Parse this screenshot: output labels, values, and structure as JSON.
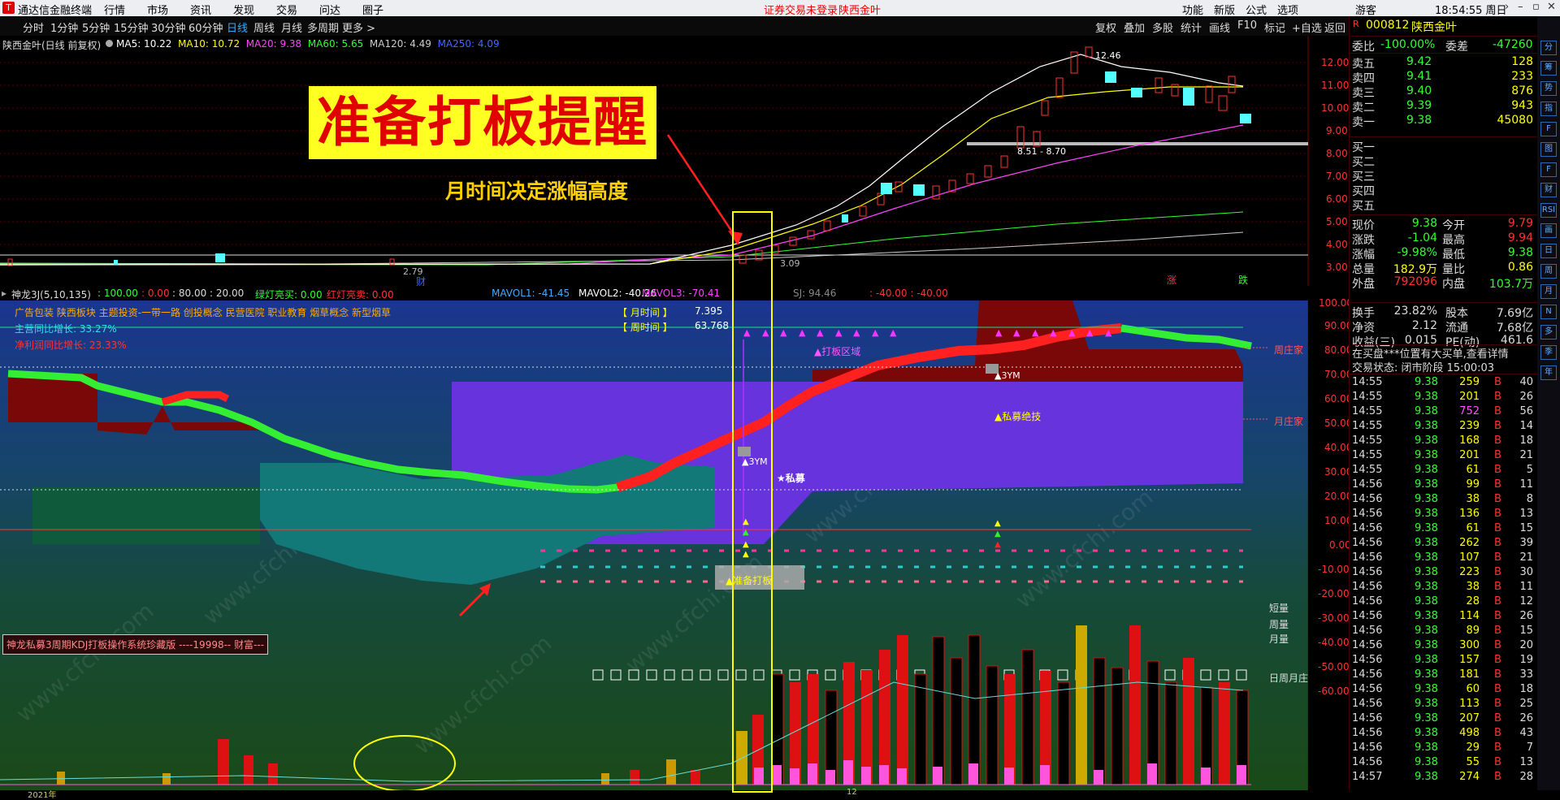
{
  "app": {
    "name": "通达信金融终端",
    "menus": [
      "行情",
      "市场",
      "资讯",
      "发现",
      "交易",
      "问达",
      "圈子"
    ],
    "notice": "证券交易未登录",
    "notice_stock": "陕西金叶",
    "right_menus": [
      "功能",
      "新版",
      "公式",
      "选项"
    ],
    "user": "游客",
    "clock": "18:54:55 周日"
  },
  "periods": [
    "分时",
    "1分钟",
    "5分钟",
    "15分钟",
    "30分钟",
    "60分钟",
    "日线",
    "周线",
    "月线",
    "多周期",
    "更多 >"
  ],
  "active_period": "日线",
  "toolbar": [
    "复权",
    "叠加",
    "多股",
    "统计",
    "画线",
    "F10",
    "标记",
    "+自选",
    "返回"
  ],
  "main": {
    "title": "陕西金叶(日线 前复权)",
    "ma": [
      {
        "label": "MA5: 10.22",
        "color": "#ffffff"
      },
      {
        "label": "MA10: 10.72",
        "color": "#ffff00"
      },
      {
        "label": "MA20: 9.38",
        "color": "#ff44ff"
      },
      {
        "label": "MA60: 5.65",
        "color": "#33ff33"
      },
      {
        "label": "MA120: 4.49",
        "color": "#cccccc"
      },
      {
        "label": "MA250: 4.09",
        "color": "#4466ff"
      }
    ],
    "banner": "准备打板提醒",
    "subtitle": "月时间决定涨幅高度",
    "high_label": "12.46",
    "range_label": "8.51 - 8.70",
    "low_label_1": "2.79",
    "low_label_2": "3.09",
    "marker_cai": "财",
    "marker_zhang": "涨",
    "marker_die": "跌",
    "price_ticks": [
      "12.00",
      "11.00",
      "10.00",
      "9.00",
      "8.00",
      "7.00",
      "6.00",
      "5.00",
      "4.00",
      "3.00"
    ]
  },
  "indicator_line": {
    "name": "神龙3J(5,10,135)",
    "vals": [
      ": 100.00",
      ": 0.00",
      ": 80.00 : 20.00"
    ],
    "green": "绿灯亮买: 0.00",
    "red": "红灯亮卖: 0.00",
    "mavol1": "MAVOL1: -41.45",
    "mavol2": "MAVOL2: -40.26",
    "mavol3": "MAVOL3: -70.41",
    "sj": "SJ: 94.46",
    "tail": ": -40.00  : -40.00"
  },
  "lower": {
    "concepts": "广告包装 陕西板块 主题投资-一带一路 创投概念 民营医院 职业教育 烟草概念 新型烟草",
    "growth1": "主营同比增长: 33.27%",
    "growth2": "净利润同比增长: 23.33%",
    "month_time_label": "【 月时间 】",
    "month_time_val": "7.395",
    "week_time_label": "【 周时间 】",
    "week_time_val": "63.768",
    "zone": "▲打板区域",
    "ym1": "▲3YM",
    "ym2": "▲3YM",
    "private": "★私募",
    "private_breakout": "▲私募绝技",
    "ready": "▲准备打板",
    "zhou_zhuang": "周庄家",
    "yue_zhuang": "月庄家",
    "short_vol": "短量",
    "week_vol": "周量",
    "month_vol": "月量",
    "dwm": "日周月庄",
    "signature": "神龙私募3周期KDJ打板操作系统珍藏版 ----19998-- 财富---",
    "axis": [
      "100.00",
      "90.00",
      "80.00",
      "70.00",
      "60.00",
      "50.00",
      "40.00",
      "30.00",
      "20.00",
      "10.00",
      "0.00",
      "-10.00",
      "-20.00",
      "-30.00",
      "-40.00",
      "-50.00",
      "-60.00"
    ],
    "watermark": "www.cfchi.com",
    "date_start": "2021年",
    "date_mid": "12"
  },
  "quote": {
    "code": "000812",
    "name": "陕西金叶",
    "wei_bi_label": "委比",
    "wei_bi": "-100.00%",
    "wei_cha_label": "委差",
    "wei_cha": "-47260",
    "asks": [
      {
        "label": "卖五",
        "price": "9.42",
        "vol": "128"
      },
      {
        "label": "卖四",
        "price": "9.41",
        "vol": "233"
      },
      {
        "label": "卖三",
        "price": "9.40",
        "vol": "876"
      },
      {
        "label": "卖二",
        "price": "9.39",
        "vol": "943"
      },
      {
        "label": "卖一",
        "price": "9.38",
        "vol": "45080"
      }
    ],
    "bids": [
      "买一",
      "买二",
      "买三",
      "买四",
      "买五"
    ],
    "stats": [
      {
        "l1": "现价",
        "v1": "9.38",
        "l2": "今开",
        "v2": "9.79",
        "c1": "#33ff33",
        "c2": "#ff3333"
      },
      {
        "l1": "涨跌",
        "v1": "-1.04",
        "l2": "最高",
        "v2": "9.94",
        "c1": "#33ff33",
        "c2": "#ff3333"
      },
      {
        "l1": "涨幅",
        "v1": "-9.98%",
        "l2": "最低",
        "v2": "9.38",
        "c1": "#33ff33",
        "c2": "#33ff33"
      },
      {
        "l1": "总量",
        "v1": "182.9万",
        "l2": "量比",
        "v2": "0.86",
        "c1": "#ffff00",
        "c2": "#ffff00"
      },
      {
        "l1": "外盘",
        "v1": "792096",
        "l2": "内盘",
        "v2": "103.7万",
        "c1": "#ff3333",
        "c2": "#33ff33"
      }
    ],
    "stats2": [
      {
        "l1": "换手",
        "v1": "23.82%",
        "l2": "股本",
        "v2": "7.69亿"
      },
      {
        "l1": "净资",
        "v1": "2.12",
        "l2": "流通",
        "v2": "7.68亿"
      },
      {
        "l1": "收益(三)",
        "v1": "0.015",
        "l2": "PE(动)",
        "v2": "461.6"
      }
    ],
    "notice": "在买盘***位置有大买单,查看详情",
    "status": "交易状态: 闭市阶段 15:00:03",
    "ticks": [
      {
        "t": "14:55",
        "p": "9.38",
        "v": "259",
        "s": "B",
        "n": "40"
      },
      {
        "t": "14:55",
        "p": "9.38",
        "v": "201",
        "s": "B",
        "n": "26"
      },
      {
        "t": "14:55",
        "p": "9.38",
        "v": "752",
        "s": "B",
        "n": "56"
      },
      {
        "t": "14:55",
        "p": "9.38",
        "v": "239",
        "s": "B",
        "n": "14"
      },
      {
        "t": "14:55",
        "p": "9.38",
        "v": "168",
        "s": "B",
        "n": "18"
      },
      {
        "t": "14:55",
        "p": "9.38",
        "v": "201",
        "s": "B",
        "n": "21"
      },
      {
        "t": "14:55",
        "p": "9.38",
        "v": "61",
        "s": "B",
        "n": "5"
      },
      {
        "t": "14:56",
        "p": "9.38",
        "v": "99",
        "s": "B",
        "n": "11"
      },
      {
        "t": "14:56",
        "p": "9.38",
        "v": "38",
        "s": "B",
        "n": "8"
      },
      {
        "t": "14:56",
        "p": "9.38",
        "v": "136",
        "s": "B",
        "n": "13"
      },
      {
        "t": "14:56",
        "p": "9.38",
        "v": "61",
        "s": "B",
        "n": "15"
      },
      {
        "t": "14:56",
        "p": "9.38",
        "v": "262",
        "s": "B",
        "n": "39"
      },
      {
        "t": "14:56",
        "p": "9.38",
        "v": "107",
        "s": "B",
        "n": "21"
      },
      {
        "t": "14:56",
        "p": "9.38",
        "v": "223",
        "s": "B",
        "n": "30"
      },
      {
        "t": "14:56",
        "p": "9.38",
        "v": "38",
        "s": "B",
        "n": "11"
      },
      {
        "t": "14:56",
        "p": "9.38",
        "v": "28",
        "s": "B",
        "n": "12"
      },
      {
        "t": "14:56",
        "p": "9.38",
        "v": "114",
        "s": "B",
        "n": "26"
      },
      {
        "t": "14:56",
        "p": "9.38",
        "v": "89",
        "s": "B",
        "n": "15"
      },
      {
        "t": "14:56",
        "p": "9.38",
        "v": "300",
        "s": "B",
        "n": "20"
      },
      {
        "t": "14:56",
        "p": "9.38",
        "v": "157",
        "s": "B",
        "n": "19"
      },
      {
        "t": "14:56",
        "p": "9.38",
        "v": "181",
        "s": "B",
        "n": "33"
      },
      {
        "t": "14:56",
        "p": "9.38",
        "v": "60",
        "s": "B",
        "n": "18"
      },
      {
        "t": "14:56",
        "p": "9.38",
        "v": "113",
        "s": "B",
        "n": "25"
      },
      {
        "t": "14:56",
        "p": "9.38",
        "v": "207",
        "s": "B",
        "n": "26"
      },
      {
        "t": "14:56",
        "p": "9.38",
        "v": "498",
        "s": "B",
        "n": "43"
      },
      {
        "t": "14:56",
        "p": "9.38",
        "v": "29",
        "s": "B",
        "n": "7"
      },
      {
        "t": "14:56",
        "p": "9.38",
        "v": "55",
        "s": "B",
        "n": "13"
      },
      {
        "t": "14:57",
        "p": "9.38",
        "v": "274",
        "s": "B",
        "n": "28"
      }
    ]
  },
  "side_tools": [
    "分",
    "筹",
    "势",
    "指",
    "F",
    "图",
    "F",
    "财",
    "RSI",
    "画",
    "日",
    "周",
    "月",
    "N",
    "多",
    "季",
    "年"
  ]
}
